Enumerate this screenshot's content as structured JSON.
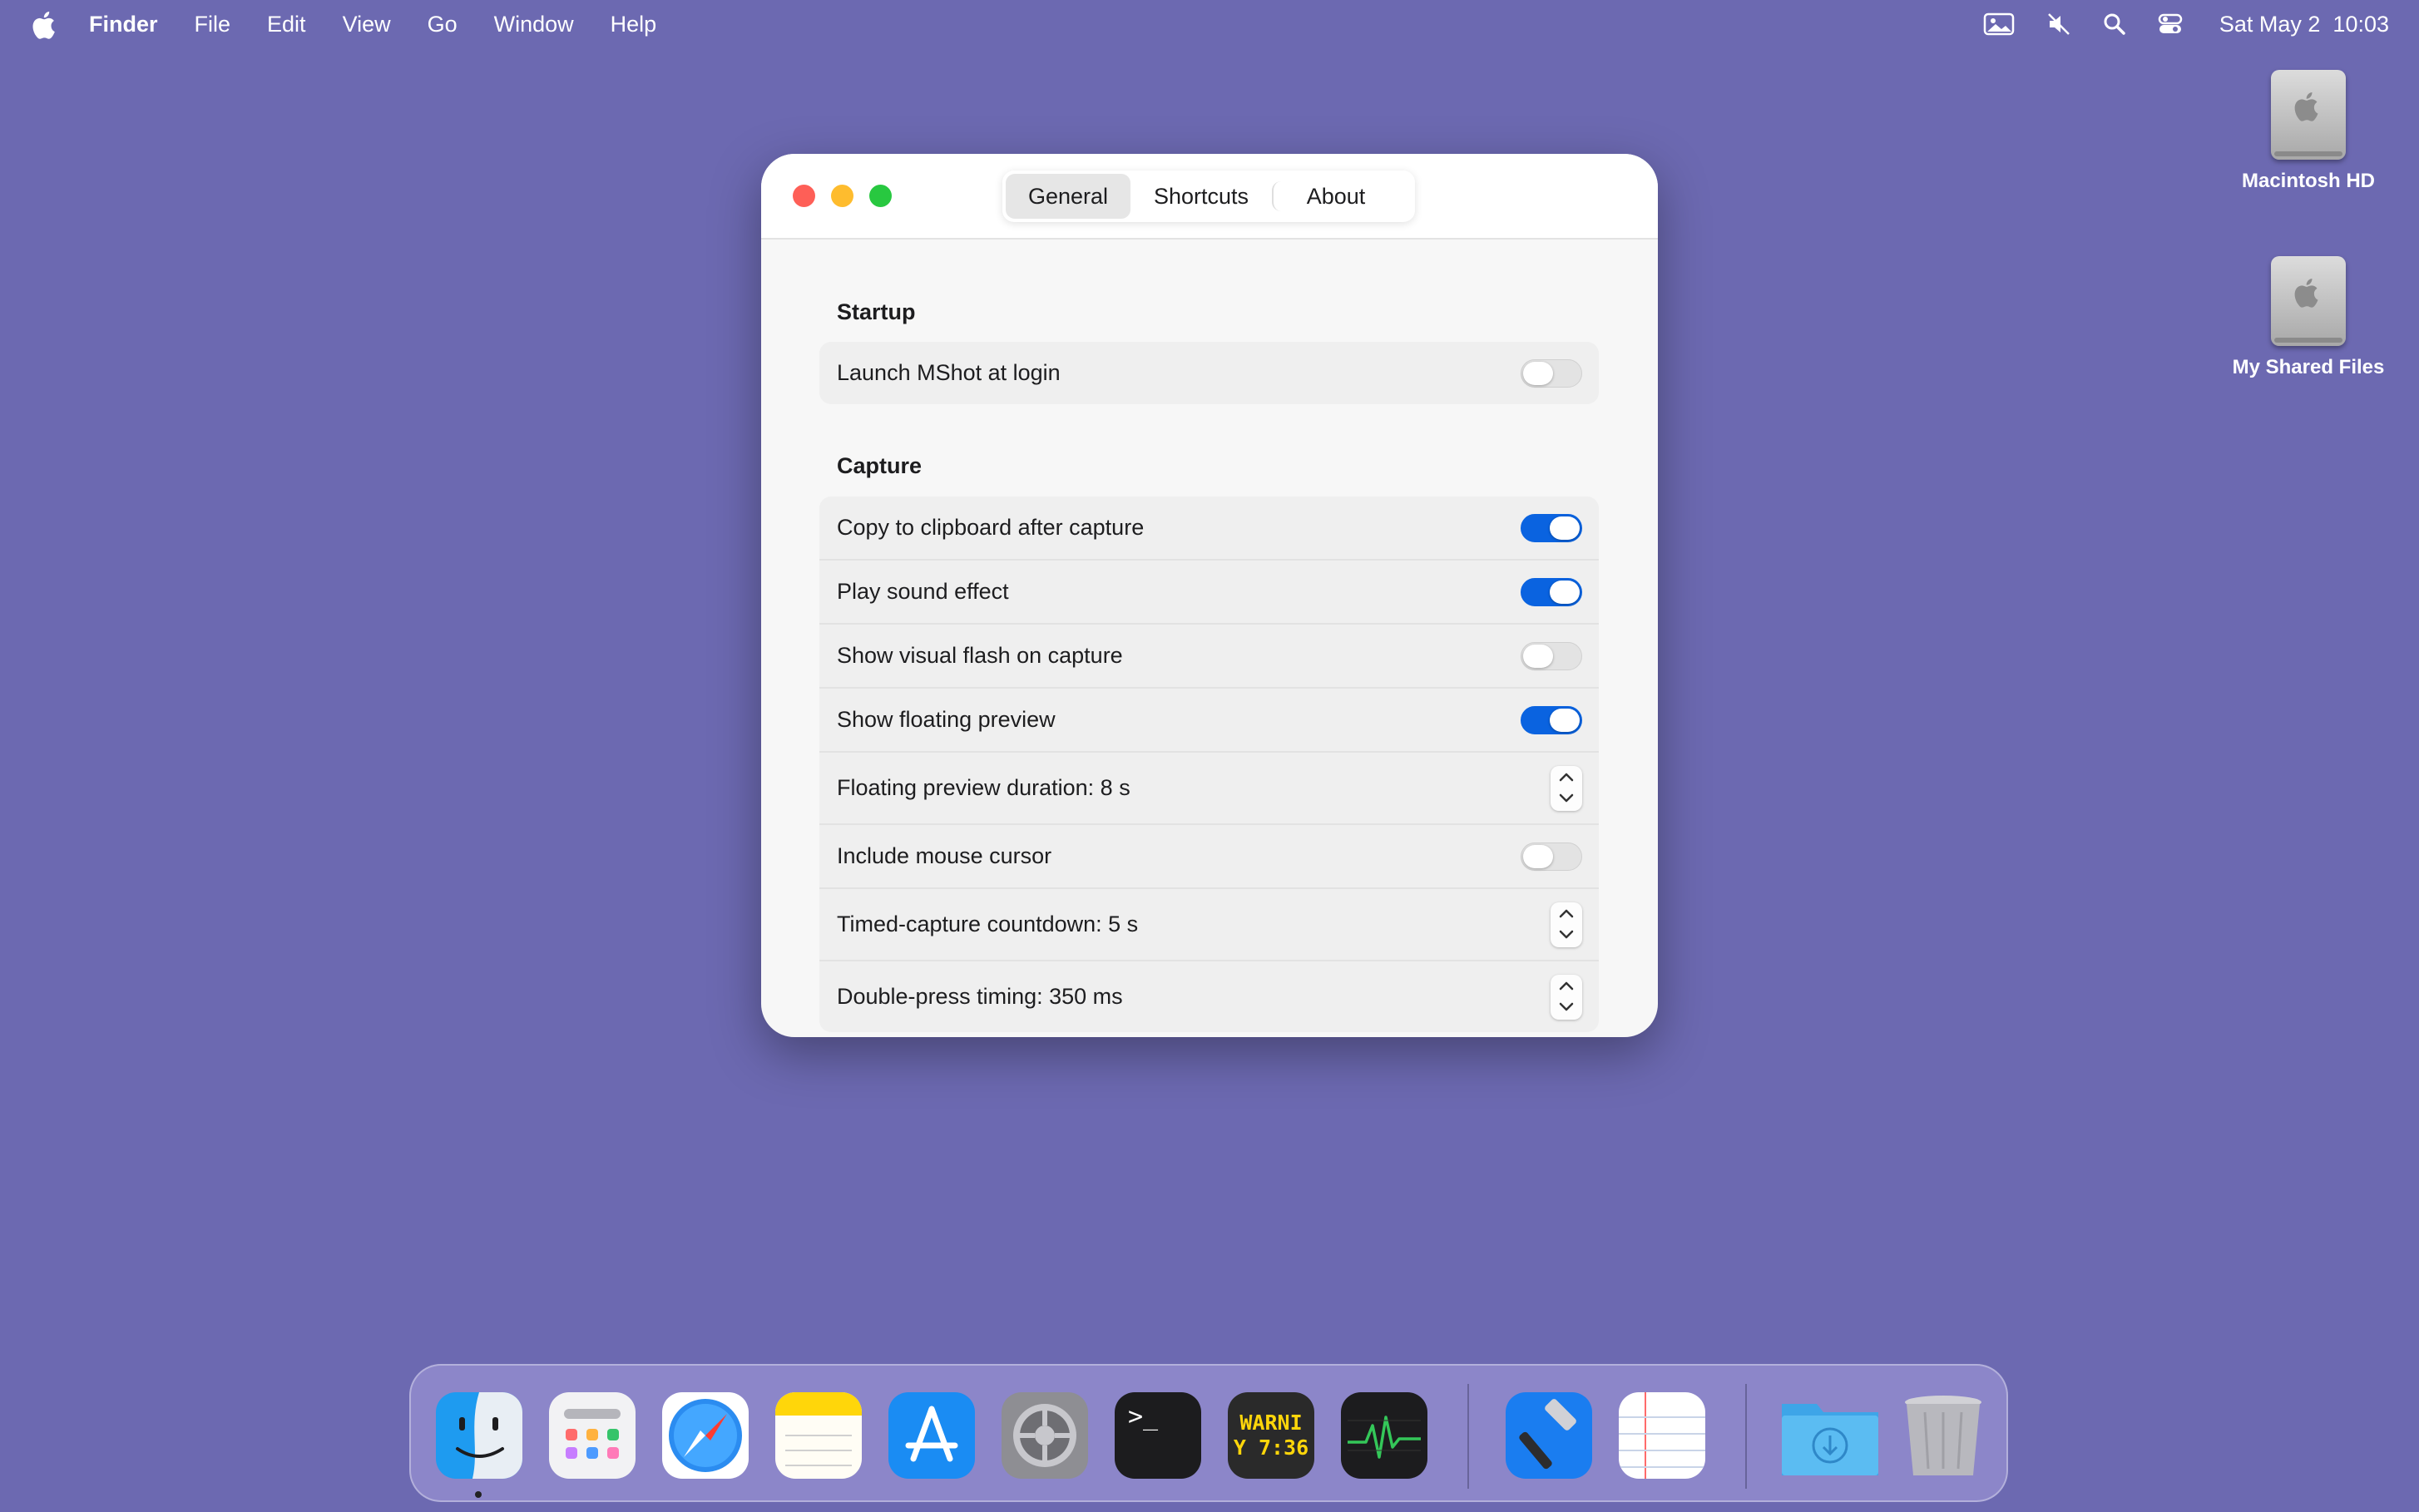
{
  "menubar": {
    "app_name": "Finder",
    "menus": [
      "File",
      "Edit",
      "View",
      "Go",
      "Window",
      "Help"
    ],
    "status_icons": [
      "screen-sharing-icon",
      "muted-speaker-icon",
      "search-icon",
      "control-center-icon"
    ],
    "clock": "Sat May 2  10:03"
  },
  "desktop": {
    "icons": [
      {
        "label": "Macintosh HD",
        "icon": "hard-drive-icon"
      },
      {
        "label": "My Shared Files",
        "icon": "hard-drive-icon"
      }
    ]
  },
  "window": {
    "tabs": [
      "General",
      "Shortcuts",
      "About"
    ],
    "active_tab": "General",
    "startup": {
      "title": "Startup",
      "rows": [
        {
          "label": "Launch MShot at login",
          "control": "toggle",
          "on": false
        }
      ]
    },
    "capture": {
      "title": "Capture",
      "rows": [
        {
          "label": "Copy to clipboard after capture",
          "control": "toggle",
          "on": true
        },
        {
          "label": "Play sound effect",
          "control": "toggle",
          "on": true
        },
        {
          "label": "Show visual flash on capture",
          "control": "toggle",
          "on": false
        },
        {
          "label": "Show floating preview",
          "control": "toggle",
          "on": true
        },
        {
          "label": "Floating preview duration: 8 s",
          "control": "stepper"
        },
        {
          "label": "Include mouse cursor",
          "control": "toggle",
          "on": false
        },
        {
          "label": "Timed-capture countdown: 5 s",
          "control": "stepper"
        },
        {
          "label": "Double-press timing: 350 ms",
          "control": "stepper"
        }
      ]
    }
  },
  "dock": {
    "apps": [
      "Finder",
      "Launchpad",
      "Safari",
      "Notes",
      "App Store",
      "System Settings",
      "Terminal",
      "Console",
      "Activity Monitor",
      "Xcode",
      "TextEdit",
      "Downloads",
      "Trash"
    ],
    "console_text": [
      "WARNI",
      "Y 7:36"
    ],
    "terminal_text": ">_"
  },
  "colors": {
    "desktop": "#6c69b1",
    "toggle_on": "#0a63e0",
    "close": "#fe5f57",
    "minimize": "#febc2e",
    "zoom": "#28c840"
  }
}
